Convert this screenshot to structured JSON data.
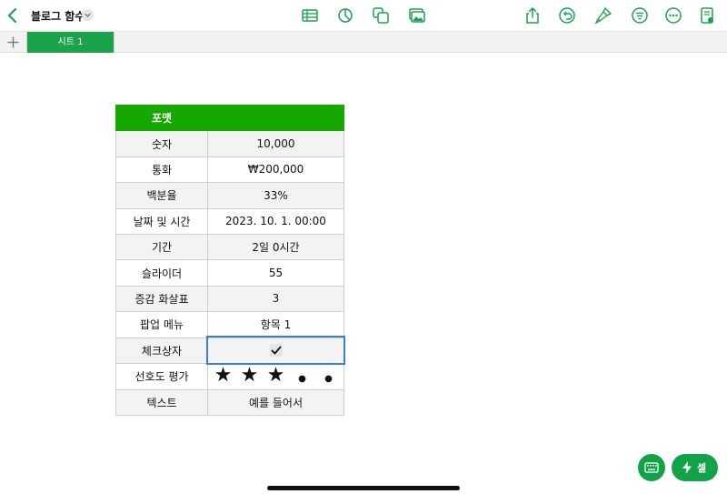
{
  "colors": {
    "accent": "#1aa34a",
    "header_green": "#16a800",
    "selection_blue": "#3a7fd5"
  },
  "toolbar": {
    "doc_title": "블로그 함수",
    "icons": [
      "back-chevron-icon",
      "table-icon",
      "chart-icon",
      "shapes-icon",
      "media-icon",
      "share-icon",
      "undo-icon",
      "format-brush-icon",
      "organize-icon",
      "more-icon",
      "document-setup-icon"
    ]
  },
  "tabs": {
    "add_icon": "plus-icon",
    "sheets": [
      {
        "label": "시트 1",
        "selected": true
      }
    ]
  },
  "table": {
    "header": {
      "col1": "포맷",
      "col2": ""
    },
    "rows": [
      {
        "label": "숫자",
        "value": "10,000"
      },
      {
        "label": "통화",
        "value": "₩200,000"
      },
      {
        "label": "백분율",
        "value": "33%"
      },
      {
        "label": "날짜 및 시간",
        "value": "2023. 10. 1. 00:00"
      },
      {
        "label": "기간",
        "value": "2일 0시간"
      },
      {
        "label": "슬라이더",
        "value": "55"
      },
      {
        "label": "증감 화살표",
        "value": "3"
      },
      {
        "label": "팝업 메뉴",
        "value": "항목 1"
      },
      {
        "label": "체크상자",
        "checked": true
      },
      {
        "label": "선호도 평가",
        "rating": 3,
        "rating_max": 5
      },
      {
        "label": "텍스트",
        "value": "예를 들어서"
      }
    ]
  },
  "bottom": {
    "keyboard_icon": "keyboard-icon",
    "cell_button_label": "셀",
    "cell_button_icon": "lightning-icon"
  }
}
